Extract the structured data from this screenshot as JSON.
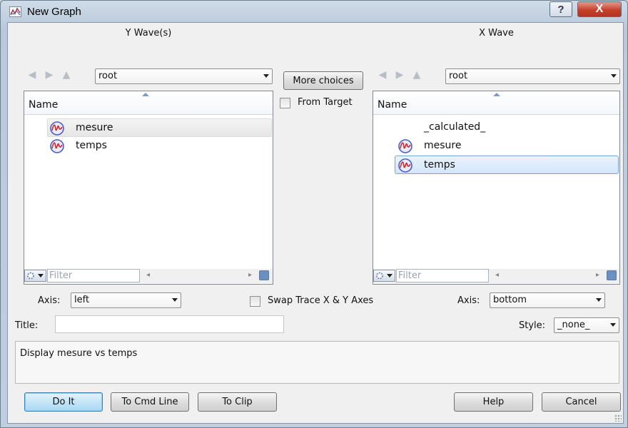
{
  "window": {
    "title": "New Graph"
  },
  "title_buttons": {
    "help": "?",
    "close": "X"
  },
  "y_panel": {
    "title": "Y Wave(s)",
    "folder": "root",
    "column_header": "Name",
    "items": [
      {
        "label": "mesure",
        "state": "hover",
        "icon": "wave-icon"
      },
      {
        "label": "temps",
        "state": "normal",
        "icon": "wave-icon"
      }
    ],
    "filter_placeholder": "Filter",
    "axis_label": "Axis:",
    "axis_value": "left"
  },
  "x_panel": {
    "title": "X Wave",
    "folder": "root",
    "column_header": "Name",
    "items": [
      {
        "label": "_calculated_",
        "state": "normal",
        "icon": ""
      },
      {
        "label": "mesure",
        "state": "normal",
        "icon": "wave-icon"
      },
      {
        "label": "temps",
        "state": "selected",
        "icon": "wave-icon"
      }
    ],
    "filter_placeholder": "Filter",
    "axis_label": "Axis:",
    "axis_value": "bottom"
  },
  "center": {
    "more_choices": "More choices",
    "from_target": "From Target",
    "from_target_checked": false,
    "swap_axes": "Swap Trace X & Y Axes",
    "swap_axes_checked": false
  },
  "title_field": {
    "label": "Title:",
    "value": ""
  },
  "style": {
    "label": "Style:",
    "value": "_none_"
  },
  "command_preview": "Display mesure vs temps",
  "buttons": {
    "do_it": "Do It",
    "to_cmd_line": "To Cmd Line",
    "to_clip": "To Clip",
    "help": "Help",
    "cancel": "Cancel"
  }
}
